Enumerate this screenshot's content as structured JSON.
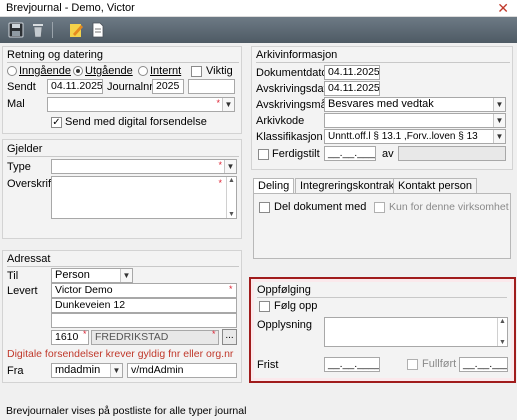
{
  "window": {
    "title": "Brevjournal - Demo, Victor",
    "close_glyph": "✕"
  },
  "toolbar": {
    "buttons": [
      "save-icon",
      "delete-icon",
      "edit-icon",
      "document-icon"
    ]
  },
  "retning": {
    "title": "Retning og datering",
    "radios": [
      "Inngående",
      "Utgående",
      "Internt"
    ],
    "selected": "Utgående",
    "viktig_label": "Viktig",
    "sendt_label": "Sendt",
    "sendt_value": "04.11.2025",
    "journalnr_label": "Journalnr",
    "journalnr_value": "2025",
    "journalnr_seq": "",
    "mal_label": "Mal",
    "mal_value": "",
    "digital_label": "Send med digital forsendelse",
    "digital_checked": true
  },
  "gjelder": {
    "title": "Gjelder",
    "type_label": "Type",
    "type_value": "",
    "overskrift_label": "Overskrift",
    "overskrift_value": ""
  },
  "adressat": {
    "title": "Adressat",
    "til_label": "Til",
    "til_value": "Person",
    "levert_label": "Levert",
    "name_value": "Victor  Demo",
    "street_value": "Dunkeveien 12",
    "extra_value": "",
    "postnr_value": "1610",
    "poststed_value": "FREDRIKSTAD",
    "browse_label": "...",
    "warning": "Digitale forsendelser krever gyldig fnr eller org.nr",
    "fra_label": "Fra",
    "fra_value": "mdadmin",
    "fra_path": "v/mdAdmin"
  },
  "arkiv": {
    "title": "Arkivinformasjon",
    "dokumentdato_label": "Dokumentdato",
    "dokumentdato_value": "04.11.2025",
    "avskrivingsdato_label": "Avskrivingsdato",
    "avskrivingsdato_value": "04.11.2025",
    "avskrivingsmate_label": "Avskrivingsmåte",
    "avskrivingsmate_value": "Besvares med vedtak",
    "arkivkode_label": "Arkivkode",
    "arkivkode_value": "",
    "klassifikasjon_label": "Klassifikasjon",
    "klassifikasjon_value": "Unntt.off.l § 13.1 ,Forv..loven § 13",
    "ferdigstilt_label": "Ferdigstilt",
    "ferdigstilt_value": "__.__.____",
    "av_label": "av",
    "av_value": ""
  },
  "tabs": {
    "items": [
      "Deling",
      "Integreringskontrakt",
      "Kontakt person"
    ],
    "active": "Deling",
    "del_dokument_label": "Del dokument med",
    "kun_label": "Kun for denne virksomhet"
  },
  "oppfolging": {
    "title": "Oppfølging",
    "folg_label": "Følg opp",
    "opplysning_label": "Opplysning",
    "frist_label": "Frist",
    "frist_value": "__.__.____",
    "fullfort_label": "Fullført",
    "fullfort_value": "__.__.____",
    "highlight_color": "#a01c1c"
  },
  "footer": {
    "text": "Brevjournaler vises på postliste for alle typer journal"
  }
}
